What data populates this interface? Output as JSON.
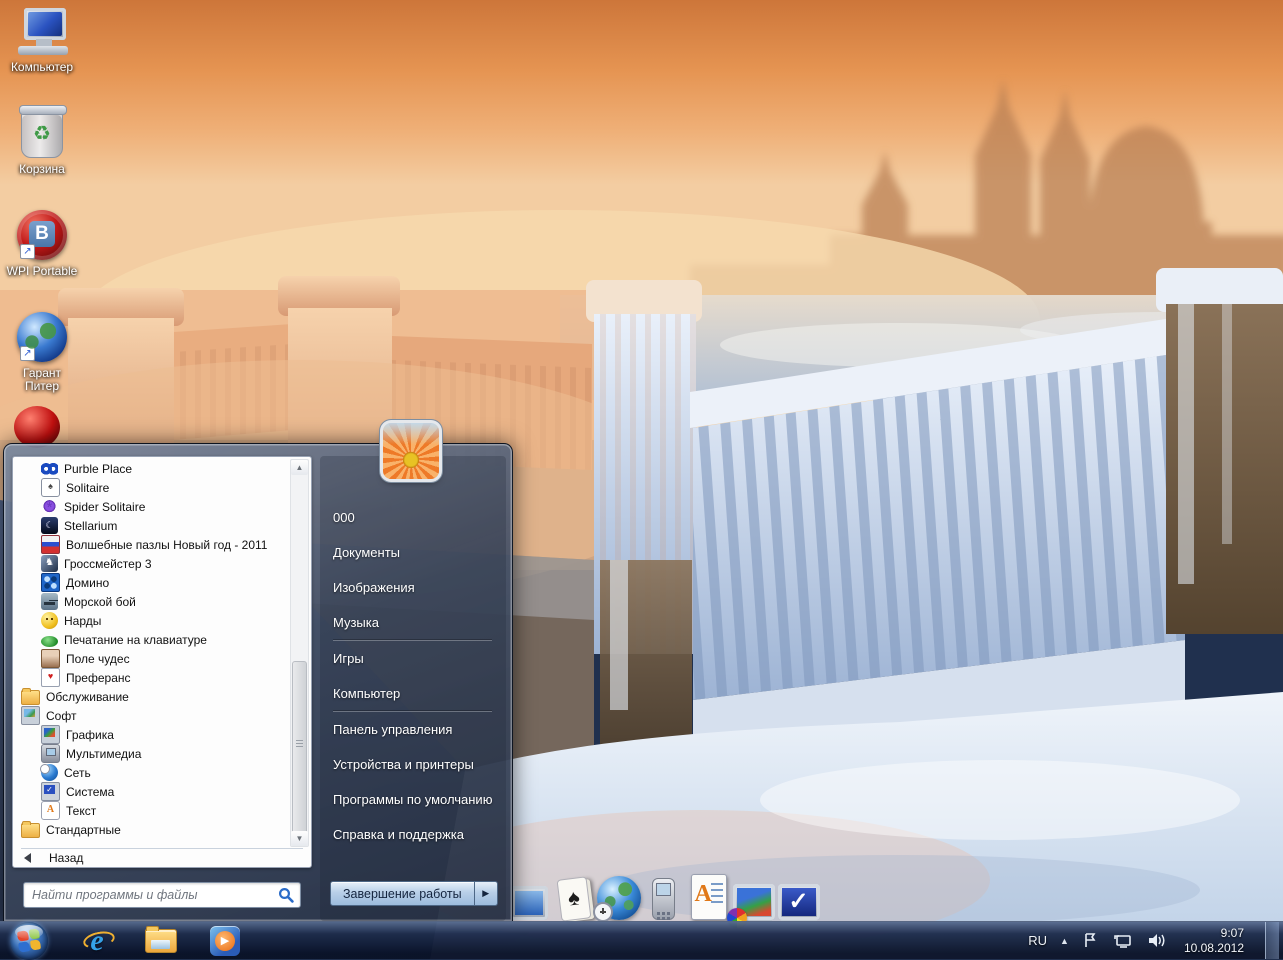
{
  "desktop": {
    "icons": [
      {
        "label": "Компьютер",
        "icon": "my-computer-icon"
      },
      {
        "label": "Корзина",
        "icon": "recycle-bin-icon"
      },
      {
        "label": "WPI Portable",
        "icon": "wpi-portable-icon"
      },
      {
        "label": "Гарант Питер",
        "icon": "garant-piter-globe-icon"
      }
    ]
  },
  "start_menu": {
    "user_name": "000",
    "programs": [
      {
        "label": "Purble Place",
        "icon": "purble-place-icon",
        "indent": 1
      },
      {
        "label": "Solitaire",
        "icon": "solitaire-icon",
        "indent": 1
      },
      {
        "label": "Spider Solitaire",
        "icon": "spider-solitaire-icon",
        "indent": 1
      },
      {
        "label": "Stellarium",
        "icon": "stellarium-icon",
        "indent": 1
      },
      {
        "label": "Волшебные пазлы Новый год - 2011",
        "icon": "puzzles-icon",
        "indent": 1
      },
      {
        "label": "Гроссмейстер 3",
        "icon": "chess-icon",
        "indent": 1
      },
      {
        "label": "Домино",
        "icon": "domino-icon",
        "indent": 1
      },
      {
        "label": "Морской бой",
        "icon": "battleship-icon",
        "indent": 1
      },
      {
        "label": "Нарды",
        "icon": "backgammon-icon",
        "indent": 1
      },
      {
        "label": "Печатание на клавиатуре",
        "icon": "typing-icon",
        "indent": 1
      },
      {
        "label": "Поле чудес",
        "icon": "pole-chudes-icon",
        "indent": 1
      },
      {
        "label": "Преферанс",
        "icon": "preferans-icon",
        "indent": 1
      },
      {
        "label": "Обслуживание",
        "icon": "folder-icon",
        "indent": 0
      },
      {
        "label": "Софт",
        "icon": "soft-icon",
        "indent": 0
      },
      {
        "label": "Графика",
        "icon": "graphics-icon",
        "indent": 1
      },
      {
        "label": "Мультимедиа",
        "icon": "multimedia-icon",
        "indent": 1
      },
      {
        "label": "Сеть",
        "icon": "network-globe-icon",
        "indent": 1
      },
      {
        "label": "Система",
        "icon": "system-icon",
        "indent": 1
      },
      {
        "label": "Текст",
        "icon": "text-icon",
        "indent": 1
      },
      {
        "label": "Стандартные",
        "icon": "folder-icon",
        "indent": 0
      }
    ],
    "back_label": "Назад",
    "search": {
      "placeholder": "Найти программы и файлы"
    },
    "right_items": [
      {
        "label": "Документы"
      },
      {
        "label": "Изображения"
      },
      {
        "label": "Музыка"
      },
      {
        "label": "Игры"
      },
      {
        "label": "Компьютер"
      },
      {
        "label": "Панель управления"
      },
      {
        "label": "Устройства и принтеры"
      },
      {
        "label": "Программы по умолчанию"
      },
      {
        "label": "Справка и поддержка"
      }
    ],
    "shutdown_label": "Завершение работы"
  },
  "dock": {
    "icons": [
      {
        "icon": "app-window-icon"
      },
      {
        "icon": "playing-cards-icon"
      },
      {
        "icon": "globe-clock-icon"
      },
      {
        "icon": "phone-icon"
      },
      {
        "icon": "text-document-icon"
      },
      {
        "icon": "graphics-monitor-icon"
      },
      {
        "icon": "system-check-icon"
      }
    ]
  },
  "taskbar": {
    "buttons": [
      {
        "icon": "internet-explorer-icon"
      },
      {
        "icon": "windows-explorer-icon"
      },
      {
        "icon": "windows-media-player-icon"
      }
    ]
  },
  "tray": {
    "language": "RU",
    "time": "9:07",
    "date": "10.08.2012"
  },
  "colors": {
    "sky_orange": "#e08a4a",
    "frost_blue": "#dfe8f5",
    "menu_glass": "#46586e",
    "taskbar_navy": "#101c38",
    "accent_blue": "#2a6bc8"
  }
}
